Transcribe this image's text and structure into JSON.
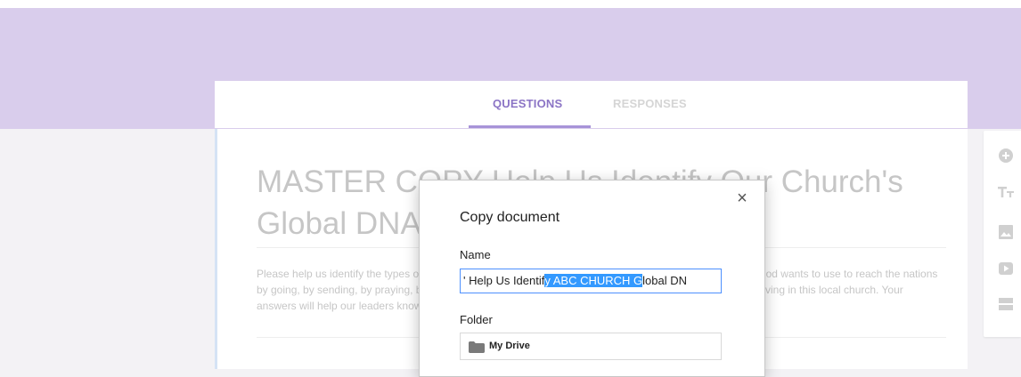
{
  "tabs": {
    "questions": "QUESTIONS",
    "responses": "RESPONSES"
  },
  "form": {
    "title": "MASTER COPY Help Us Identify Our Church's Global DNA",
    "description": "Please help us identify the types of missions work your church is involved in. Each of us may be just what God wants to use to reach the nations by going, by sending, by praying, by giving, by welcoming, or by staying right here and training others or serving in this local church. Your answers will help our leaders know how God would use them."
  },
  "toolbar": {
    "icons": [
      "add-question-icon",
      "add-title-icon",
      "add-image-icon",
      "add-video-icon",
      "add-section-icon"
    ]
  },
  "dialog": {
    "title": "Copy document",
    "close_glyph": "×",
    "name_label": "Name",
    "name_value_before": "' Help Us Identif",
    "name_value_selected": "y ABC CHURCH G",
    "name_value_after": "lobal DN",
    "folder_label": "Folder",
    "folder_value": "My Drive"
  },
  "colors": {
    "header": "#d9cdec",
    "accent": "#8b74c5",
    "selection": "#3399ff",
    "focus": "#4d90fe"
  }
}
